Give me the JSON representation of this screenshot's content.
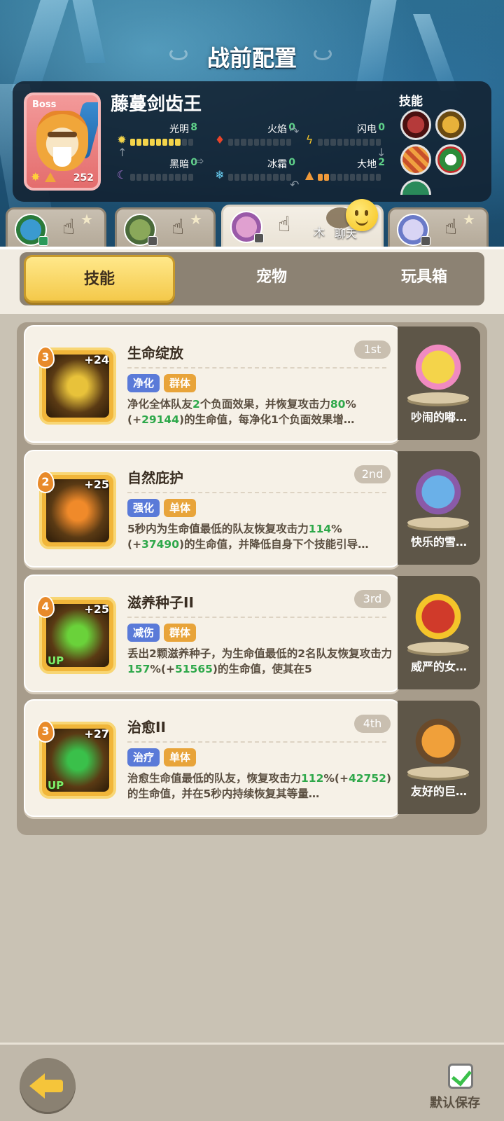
{
  "page_title": "战前配置",
  "boss": {
    "tag": "Boss",
    "name": "藤蔓剑齿王",
    "level": "252",
    "elements": {
      "light": {
        "label": "光明",
        "value": "8",
        "fill": 8
      },
      "fire": {
        "label": "火焰",
        "value": "0",
        "fill": 0
      },
      "bolt": {
        "label": "闪电",
        "value": "0",
        "fill": 0
      },
      "dark": {
        "label": "黑暗",
        "value": "0",
        "fill": 0
      },
      "frost": {
        "label": "冰霜",
        "value": "0",
        "fill": 0
      },
      "earth": {
        "label": "大地",
        "value": "2",
        "fill": 2
      }
    },
    "skills_title": "技能"
  },
  "team": {
    "chat_label": "聊天",
    "chat_prefix": "木"
  },
  "tabs": [
    {
      "label": "技能",
      "active": true
    },
    {
      "label": "宠物",
      "active": false
    },
    {
      "label": "玩具箱",
      "active": false
    }
  ],
  "skills": [
    {
      "level": "3",
      "bonus": "+24",
      "up": "",
      "title": "生命绽放",
      "rank": "1st",
      "tag1": "净化",
      "tag2": "群体",
      "desc_parts": [
        "净化全体队友",
        "2",
        "个负面效果，并恢复攻击力",
        "80",
        "%(+",
        "29144",
        ")的生命值，每净化1个负面效果增…"
      ],
      "pet": "吵闹的嘟…",
      "color": "#e8c23a"
    },
    {
      "level": "2",
      "bonus": "+25",
      "up": "",
      "title": "自然庇护",
      "rank": "2nd",
      "tag1": "强化",
      "tag2": "单体",
      "desc_parts": [
        "5秒内为生命值最低的队友恢复攻击力",
        "114",
        "%(+",
        "37490",
        ")的生命值，并降低自身下个技能引导…",
        "",
        ""
      ],
      "pet": "快乐的雪…",
      "color": "#f08a2a"
    },
    {
      "level": "4",
      "bonus": "+25",
      "up": "UP",
      "title": "滋养种子II",
      "rank": "3rd",
      "tag1": "减伤",
      "tag2": "群体",
      "desc_parts": [
        "丢出2颗滋养种子，为生命值最低的2名队友恢复攻击力",
        "157",
        "%(+",
        "51565",
        ")的生命值，使其在5",
        "",
        ""
      ],
      "pet": "威严的女…",
      "color": "#6ad23a"
    },
    {
      "level": "3",
      "bonus": "+27",
      "up": "UP",
      "title": "治愈II",
      "rank": "4th",
      "tag1": "治疗",
      "tag2": "单体",
      "desc_parts": [
        "治愈生命值最低的队友，恢复攻击力",
        "112",
        "%(+",
        "42752",
        ")的生命值，并在5秒内持续恢复其等量…",
        "",
        ""
      ],
      "pet": "友好的巨…",
      "color": "#3ac04a"
    }
  ],
  "footer": {
    "save_label": "默认保存"
  }
}
